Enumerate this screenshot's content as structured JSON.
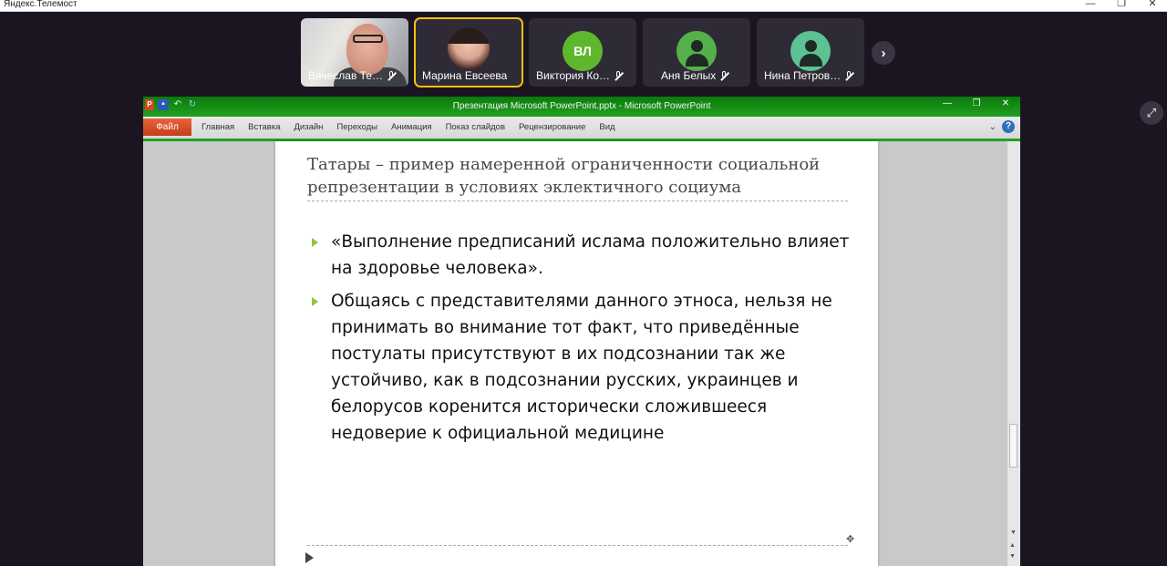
{
  "app": {
    "title": "Яндекс.Телемост",
    "win_controls": [
      "—",
      "❐",
      "✕"
    ]
  },
  "participants": [
    {
      "name": "Вячеслав Те…",
      "type": "video",
      "muted": true
    },
    {
      "name": "Марина Евсеева",
      "type": "photo",
      "muted": false,
      "active": true
    },
    {
      "name": "Виктория Ко…",
      "type": "initials",
      "initials": "ВЛ",
      "color": "#5fb82c",
      "muted": true
    },
    {
      "name": "Аня Белых",
      "type": "icon",
      "color": "#55b04b",
      "muted": true
    },
    {
      "name": "Нина Петров…",
      "type": "icon",
      "color": "#5cc293",
      "muted": true
    }
  ],
  "controls": {
    "next_label": "›",
    "fullscreen_label": "⤢"
  },
  "ppt": {
    "logo": "P",
    "title": "Презентация Microsoft PowerPoint.pptx - Microsoft PowerPoint",
    "file_tab": "Файл",
    "tabs": [
      "Главная",
      "Вставка",
      "Дизайн",
      "Переходы",
      "Анимация",
      "Показ слайдов",
      "Рецензирование",
      "Вид"
    ],
    "help": "?",
    "collapse": "⌄"
  },
  "slide": {
    "title": "Татары – пример намеренной ограниченности социальной репрезентации в условиях эклектичного социума",
    "bullets": [
      "«Выполнение предписаний ислама положительно влияет на здоровье человека».",
      "Общаясь с представителями данного этноса, нельзя не принимать во внимание тот факт, что приведённые постулаты присутствуют в их подсознании так же устойчиво, как в подсознании русских, украинцев и белорусов коренится исторически сложившееся недоверие к официальной медицине"
    ]
  }
}
